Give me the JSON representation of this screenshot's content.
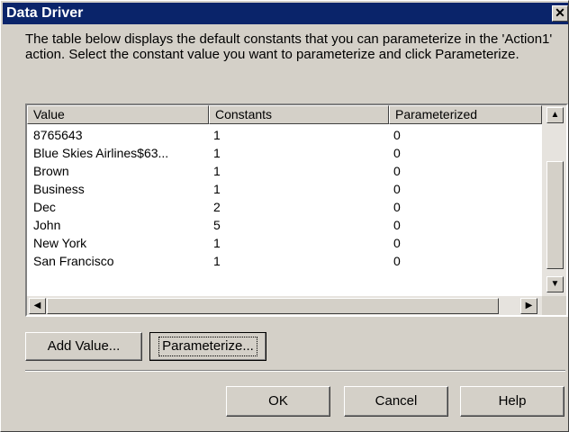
{
  "dialog": {
    "title": "Data Driver",
    "close_glyph": "✕",
    "description": "The table below displays the default constants that you can parameterize in the 'Action1' action. Select the constant value you want to parameterize and click Parameterize."
  },
  "table": {
    "columns": [
      "Value",
      "Constants",
      "Parameterized"
    ],
    "rows": [
      [
        "8765643",
        "1",
        "0"
      ],
      [
        "Blue Skies Airlines$63...",
        "1",
        "0"
      ],
      [
        "Brown",
        "1",
        "0"
      ],
      [
        "Business",
        "1",
        "0"
      ],
      [
        "Dec",
        "2",
        "0"
      ],
      [
        "John",
        "5",
        "0"
      ],
      [
        "New York",
        "1",
        "0"
      ],
      [
        "San Francisco",
        "1",
        "0"
      ]
    ],
    "scroll_up_glyph": "▲",
    "scroll_down_glyph": "▼",
    "scroll_left_glyph": "◀",
    "scroll_right_glyph": "▶"
  },
  "actions": {
    "add_value_label": "Add Value...",
    "parameterize_label": "Parameterize..."
  },
  "footer": {
    "ok_label": "OK",
    "cancel_label": "Cancel",
    "help_label": "Help"
  }
}
